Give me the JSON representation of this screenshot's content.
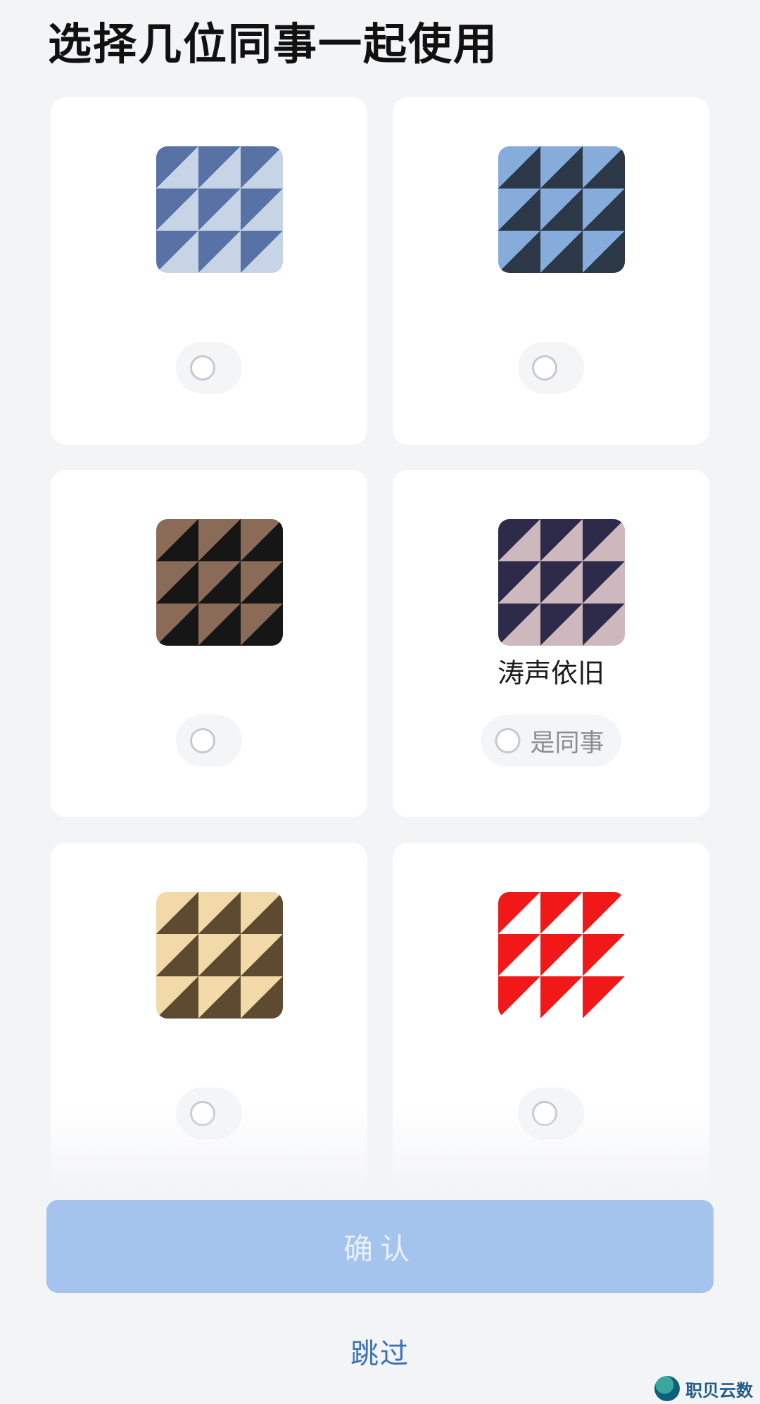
{
  "header": {
    "title": "选择几位同事一起使用"
  },
  "cards": [
    {
      "name": "",
      "radio_label": "",
      "avatar_style": "av-blue"
    },
    {
      "name": "",
      "radio_label": "",
      "avatar_style": "av-sky"
    },
    {
      "name": "",
      "radio_label": "",
      "avatar_style": "av-brown"
    },
    {
      "name": "涛声依旧",
      "radio_label": "是同事",
      "avatar_style": "av-mix"
    },
    {
      "name": "",
      "radio_label": "",
      "avatar_style": "av-gold"
    },
    {
      "name": "",
      "radio_label": "",
      "avatar_style": "av-red"
    }
  ],
  "footer": {
    "confirm_label": "确认",
    "skip_label": "跳过"
  },
  "watermark": {
    "text": "职贝云数"
  },
  "colors": {
    "confirm_bg": "#a4c4ee",
    "skip_text": "#3c72b8",
    "page_bg": "#f3f4f6"
  }
}
